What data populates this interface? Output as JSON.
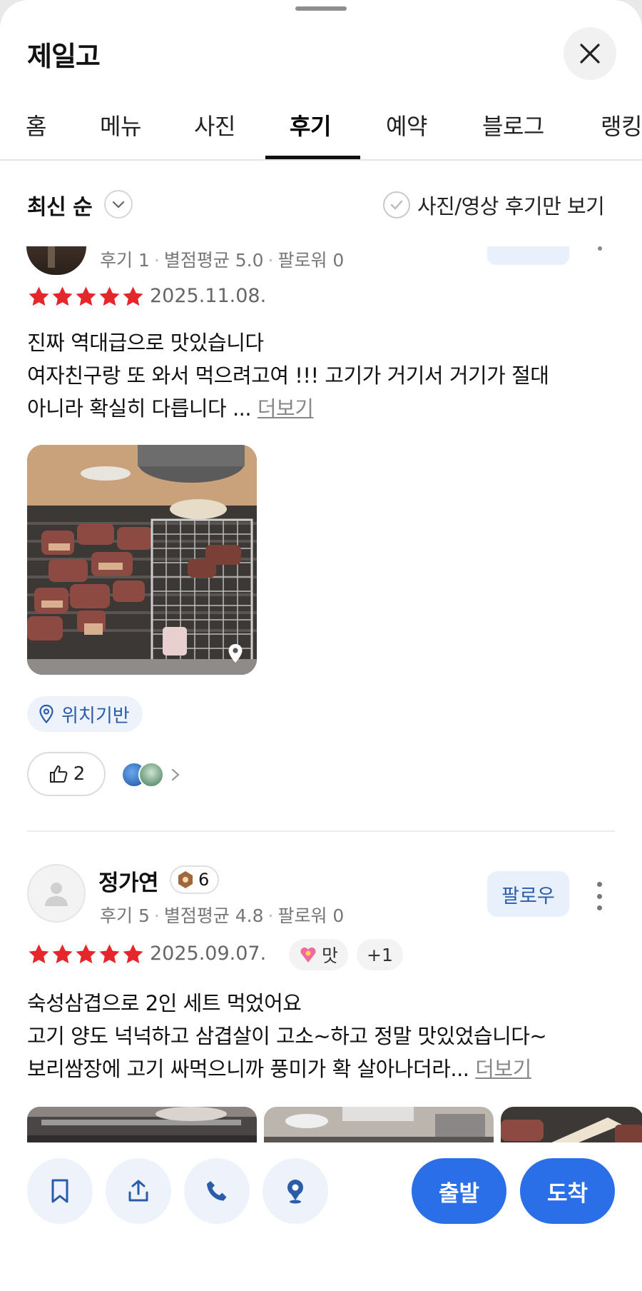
{
  "header": {
    "title": "제일고"
  },
  "tabs": [
    {
      "label": "홈"
    },
    {
      "label": "메뉴"
    },
    {
      "label": "사진"
    },
    {
      "label": "후기"
    },
    {
      "label": "예약"
    },
    {
      "label": "블로그"
    },
    {
      "label": "랭킹"
    }
  ],
  "active_tab": "후기",
  "sort": {
    "label": "최신 순",
    "photo_filter_label": "사진/영상 후기만 보기"
  },
  "reviews": [
    {
      "stats": {
        "reviews": "후기 1",
        "avg": "별점평균 5.0",
        "followers": "팔로워 0"
      },
      "rating": 5,
      "date": "2025.11.08.",
      "lines": [
        "진짜 역대급으로 맛있습니다",
        "여자친구랑 또 와서 먹으려고여 !!! 고기가 거기서 거기가 절대",
        " 아니라 확실히 다릅니다 ... "
      ],
      "more_label": "더보기",
      "location_chip": "위치기반",
      "likes": "2"
    },
    {
      "name": "정가연",
      "badge_count": "6",
      "stats": {
        "reviews": "후기 5",
        "avg": "별점평균 4.8",
        "followers": "팔로워 0"
      },
      "follow_label": "팔로우",
      "rating": 5,
      "date": "2025.09.07.",
      "tag_label": "맛",
      "tag_more": "+1",
      "lines": [
        "숙성삼겹으로 2인 세트 먹었어요",
        "고기 양도 넉넉하고 삼겹살이 고소~하고 정말 맛있었습니다~",
        "보리쌈장에 고기 싸먹으니까 풍미가 확 살아나더라... "
      ],
      "more_label": "더보기"
    }
  ],
  "bottom_bar": {
    "depart_label": "출발",
    "arrive_label": "도착",
    "icons": [
      "bookmark-icon",
      "share-icon",
      "phone-icon",
      "map-pin-icon"
    ]
  },
  "colors": {
    "accent": "#2a6ee8",
    "star": "#e5262b",
    "link": "#2a5caa"
  }
}
